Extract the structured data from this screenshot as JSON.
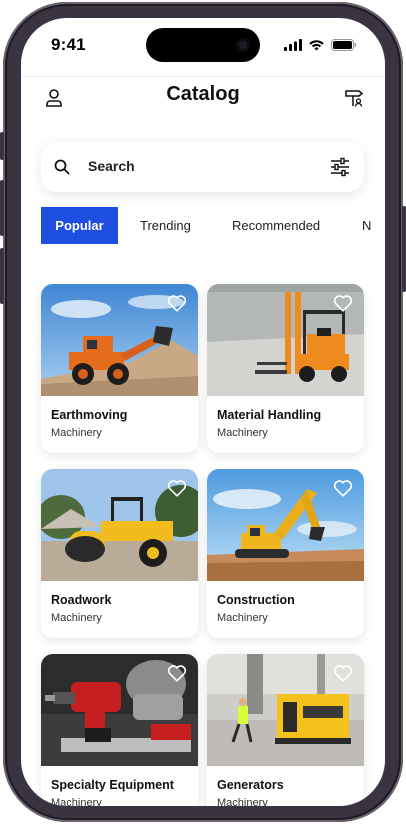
{
  "status_bar": {
    "time": "9:41"
  },
  "header": {
    "title": "Catalog",
    "left_icon": "user-icon",
    "right_icon": "signpost-icon"
  },
  "search": {
    "placeholder": "Search",
    "left_icon": "search-icon",
    "right_icon": "filter-sliders-icon"
  },
  "tabs": [
    {
      "label": "Popular",
      "active": true
    },
    {
      "label": "Trending",
      "active": false
    },
    {
      "label": "Recommended",
      "active": false
    },
    {
      "label": "N",
      "active": false
    }
  ],
  "cards": [
    {
      "name": "Earthmoving",
      "category": "Machinery"
    },
    {
      "name": "Material Handling",
      "category": "Machinery"
    },
    {
      "name": "Roadwork",
      "category": "Machinery"
    },
    {
      "name": "Construction",
      "category": "Machinery"
    },
    {
      "name": "Specialty Equipment",
      "category": "Machinery"
    },
    {
      "name": "Generators",
      "category": "Machinery"
    }
  ],
  "colors": {
    "accent": "#1d4ee0",
    "frame": "#3a3440"
  }
}
